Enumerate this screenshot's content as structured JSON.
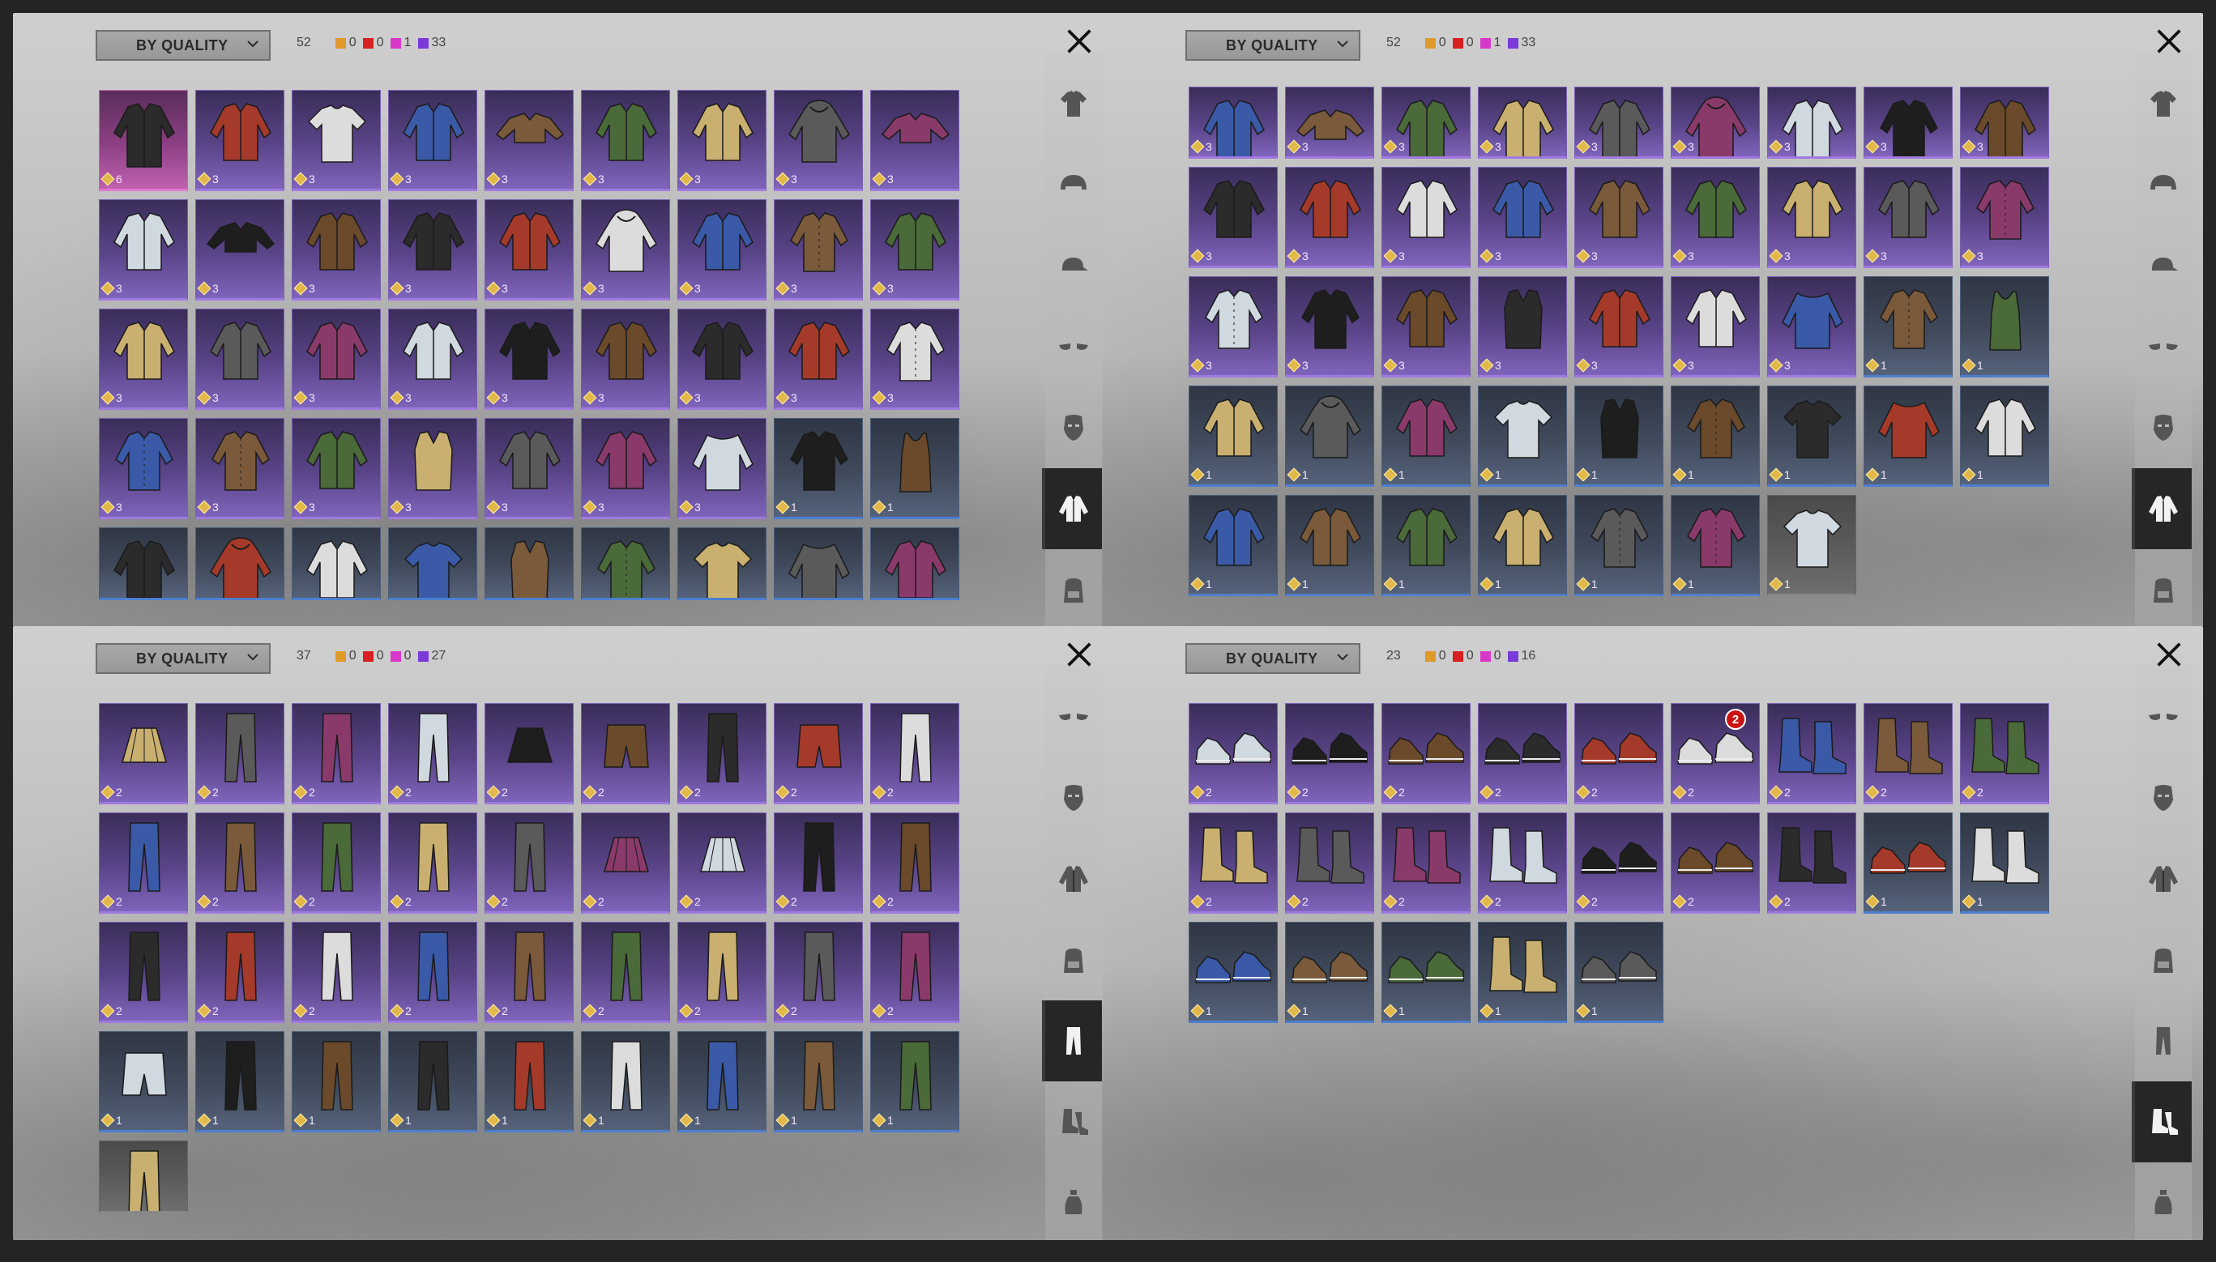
{
  "panels": [
    {
      "sort_label": "BY QUALITY",
      "total": "52",
      "counts": [
        {
          "color": "#e09a2a",
          "value": "0"
        },
        {
          "color": "#d82020",
          "value": "0"
        },
        {
          "color": "#d838c8",
          "value": "1"
        },
        {
          "color": "#7a3ad8",
          "value": "33"
        }
      ],
      "category_icon": "jacket-icon",
      "sidebar_icons": [
        "shirt-icon",
        "helmet-icon",
        "cap-icon",
        "glasses-icon",
        "mask-icon",
        "jacket-icon",
        "backpack-icon"
      ],
      "active_index": 5,
      "rows": [
        [
          {
            "t": "pink",
            "v": "6",
            "s": "coat"
          },
          {
            "t": "purple",
            "v": "3",
            "s": "jacket"
          },
          {
            "t": "purple",
            "v": "3",
            "s": "tshirt"
          },
          {
            "t": "purple",
            "v": "3",
            "s": "jacket"
          },
          {
            "t": "purple",
            "v": "3",
            "s": "crop"
          },
          {
            "t": "purple",
            "v": "3",
            "s": "jacket"
          },
          {
            "t": "purple",
            "v": "3",
            "s": "jacket"
          },
          {
            "t": "purple",
            "v": "3",
            "s": "hoodie"
          },
          {
            "t": "purple",
            "v": "3",
            "s": "crop"
          }
        ],
        [
          {
            "t": "purple",
            "v": "3",
            "s": "jacket"
          },
          {
            "t": "purple",
            "v": "3",
            "s": "crop"
          },
          {
            "t": "purple",
            "v": "3",
            "s": "jacket"
          },
          {
            "t": "purple",
            "v": "3",
            "s": "jacket"
          },
          {
            "t": "purple",
            "v": "3",
            "s": "jacket"
          },
          {
            "t": "purple",
            "v": "3",
            "s": "hoodie"
          },
          {
            "t": "purple",
            "v": "3",
            "s": "jacket"
          },
          {
            "t": "purple",
            "v": "3",
            "s": "shirt"
          },
          {
            "t": "purple",
            "v": "3",
            "s": "jacket"
          }
        ],
        [
          {
            "t": "purple",
            "v": "3",
            "s": "jacket"
          },
          {
            "t": "purple",
            "v": "3",
            "s": "jacket"
          },
          {
            "t": "purple",
            "v": "3",
            "s": "jacket"
          },
          {
            "t": "purple",
            "v": "3",
            "s": "jacket"
          },
          {
            "t": "purple",
            "v": "3",
            "s": "jacket"
          },
          {
            "t": "purple",
            "v": "3",
            "s": "jacket"
          },
          {
            "t": "purple",
            "v": "3",
            "s": "jacket"
          },
          {
            "t": "purple",
            "v": "3",
            "s": "jacket"
          },
          {
            "t": "purple",
            "v": "3",
            "s": "shirt"
          }
        ],
        [
          {
            "t": "purple",
            "v": "3",
            "s": "shirt"
          },
          {
            "t": "purple",
            "v": "3",
            "s": "shirt"
          },
          {
            "t": "purple",
            "v": "3",
            "s": "jacket"
          },
          {
            "t": "purple",
            "v": "3",
            "s": "vest"
          },
          {
            "t": "purple",
            "v": "3",
            "s": "jacket"
          },
          {
            "t": "purple",
            "v": "3",
            "s": "jacket"
          },
          {
            "t": "purple",
            "v": "3",
            "s": "sweater"
          },
          {
            "t": "blue",
            "v": "1",
            "s": "shirt"
          },
          {
            "t": "blue",
            "v": "1",
            "s": "tank"
          }
        ],
        [
          {
            "t": "blue",
            "v": "",
            "s": "jacket"
          },
          {
            "t": "blue",
            "v": "",
            "s": "hoodie"
          },
          {
            "t": "blue",
            "v": "",
            "s": "jacket"
          },
          {
            "t": "blue",
            "v": "",
            "s": "tshirt"
          },
          {
            "t": "blue",
            "v": "",
            "s": "vest"
          },
          {
            "t": "blue",
            "v": "",
            "s": "shirt"
          },
          {
            "t": "blue",
            "v": "",
            "s": "tshirt"
          },
          {
            "t": "blue",
            "v": "",
            "s": "sweater"
          },
          {
            "t": "blue",
            "v": "",
            "s": "jacket"
          }
        ]
      ]
    },
    {
      "sort_label": "BY QUALITY",
      "total": "52",
      "counts": [
        {
          "color": "#e09a2a",
          "value": "0"
        },
        {
          "color": "#d82020",
          "value": "0"
        },
        {
          "color": "#d838c8",
          "value": "1"
        },
        {
          "color": "#7a3ad8",
          "value": "33"
        }
      ],
      "sidebar_icons": [
        "shirt-icon",
        "helmet-icon",
        "cap-icon",
        "glasses-icon",
        "mask-icon",
        "jacket-icon",
        "backpack-icon"
      ],
      "active_index": 5,
      "rows": [
        [
          {
            "t": "purple",
            "v": "3",
            "s": "jacket"
          },
          {
            "t": "purple",
            "v": "3",
            "s": "crop"
          },
          {
            "t": "purple",
            "v": "3",
            "s": "jacket"
          },
          {
            "t": "purple",
            "v": "3",
            "s": "jacket"
          },
          {
            "t": "purple",
            "v": "3",
            "s": "jacket"
          },
          {
            "t": "purple",
            "v": "3",
            "s": "hoodie"
          },
          {
            "t": "purple",
            "v": "3",
            "s": "jacket"
          },
          {
            "t": "purple",
            "v": "3",
            "s": "shirt"
          },
          {
            "t": "purple",
            "v": "3",
            "s": "jacket"
          }
        ],
        [
          {
            "t": "purple",
            "v": "3",
            "s": "jacket"
          },
          {
            "t": "purple",
            "v": "3",
            "s": "jacket"
          },
          {
            "t": "purple",
            "v": "3",
            "s": "jacket"
          },
          {
            "t": "purple",
            "v": "3",
            "s": "jacket"
          },
          {
            "t": "purple",
            "v": "3",
            "s": "jacket"
          },
          {
            "t": "purple",
            "v": "3",
            "s": "jacket"
          },
          {
            "t": "purple",
            "v": "3",
            "s": "jacket"
          },
          {
            "t": "purple",
            "v": "3",
            "s": "jacket"
          },
          {
            "t": "purple",
            "v": "3",
            "s": "shirt"
          }
        ],
        [
          {
            "t": "purple",
            "v": "3",
            "s": "shirt"
          },
          {
            "t": "purple",
            "v": "3",
            "s": "shirt"
          },
          {
            "t": "purple",
            "v": "3",
            "s": "jacket"
          },
          {
            "t": "purple",
            "v": "3",
            "s": "vest"
          },
          {
            "t": "purple",
            "v": "3",
            "s": "jacket"
          },
          {
            "t": "purple",
            "v": "3",
            "s": "jacket"
          },
          {
            "t": "purple",
            "v": "3",
            "s": "sweater"
          },
          {
            "t": "blue",
            "v": "1",
            "s": "shirt"
          },
          {
            "t": "blue",
            "v": "1",
            "s": "tank"
          }
        ],
        [
          {
            "t": "blue",
            "v": "1",
            "s": "jacket"
          },
          {
            "t": "blue",
            "v": "1",
            "s": "hoodie"
          },
          {
            "t": "blue",
            "v": "1",
            "s": "jacket"
          },
          {
            "t": "blue",
            "v": "1",
            "s": "tshirt"
          },
          {
            "t": "blue",
            "v": "1",
            "s": "vest"
          },
          {
            "t": "blue",
            "v": "1",
            "s": "shirt"
          },
          {
            "t": "blue",
            "v": "1",
            "s": "tshirt"
          },
          {
            "t": "blue",
            "v": "1",
            "s": "sweater"
          },
          {
            "t": "blue",
            "v": "1",
            "s": "jacket"
          }
        ],
        [
          {
            "t": "blue",
            "v": "1",
            "s": "jacket"
          },
          {
            "t": "blue",
            "v": "1",
            "s": "jacket"
          },
          {
            "t": "blue",
            "v": "1",
            "s": "jacket"
          },
          {
            "t": "blue",
            "v": "1",
            "s": "jacket"
          },
          {
            "t": "blue",
            "v": "1",
            "s": "shirt"
          },
          {
            "t": "blue",
            "v": "1",
            "s": "shirt"
          },
          {
            "t": "grey",
            "v": "1",
            "s": "tshirt"
          }
        ]
      ]
    },
    {
      "sort_label": "BY QUALITY",
      "total": "37",
      "counts": [
        {
          "color": "#e09a2a",
          "value": "0"
        },
        {
          "color": "#d82020",
          "value": "0"
        },
        {
          "color": "#d838c8",
          "value": "0"
        },
        {
          "color": "#7a3ad8",
          "value": "27"
        }
      ],
      "sidebar_icons": [
        "glasses-icon",
        "mask-icon",
        "jacket-icon",
        "backpack-icon",
        "pants-icon",
        "boots-icon",
        "bottle-icon"
      ],
      "active_index": 4,
      "rows": [
        [
          {
            "t": "purple",
            "v": "2",
            "s": "skirt"
          },
          {
            "t": "purple",
            "v": "2",
            "s": "pants"
          },
          {
            "t": "purple",
            "v": "2",
            "s": "pants"
          },
          {
            "t": "purple",
            "v": "2",
            "s": "pants"
          },
          {
            "t": "purple",
            "v": "2",
            "s": "skirt"
          },
          {
            "t": "purple",
            "v": "2",
            "s": "shorts"
          },
          {
            "t": "purple",
            "v": "2",
            "s": "pants"
          },
          {
            "t": "purple",
            "v": "2",
            "s": "shorts"
          },
          {
            "t": "purple",
            "v": "2",
            "s": "pants"
          }
        ],
        [
          {
            "t": "purple",
            "v": "2",
            "s": "pants"
          },
          {
            "t": "purple",
            "v": "2",
            "s": "pants"
          },
          {
            "t": "purple",
            "v": "2",
            "s": "pants"
          },
          {
            "t": "purple",
            "v": "2",
            "s": "pants"
          },
          {
            "t": "purple",
            "v": "2",
            "s": "pants"
          },
          {
            "t": "purple",
            "v": "2",
            "s": "skirt"
          },
          {
            "t": "purple",
            "v": "2",
            "s": "skirt"
          },
          {
            "t": "purple",
            "v": "2",
            "s": "pants"
          },
          {
            "t": "purple",
            "v": "2",
            "s": "pants"
          }
        ],
        [
          {
            "t": "purple",
            "v": "2",
            "s": "pants"
          },
          {
            "t": "purple",
            "v": "2",
            "s": "pants"
          },
          {
            "t": "purple",
            "v": "2",
            "s": "pants"
          },
          {
            "t": "purple",
            "v": "2",
            "s": "pants"
          },
          {
            "t": "purple",
            "v": "2",
            "s": "pants"
          },
          {
            "t": "purple",
            "v": "2",
            "s": "pants"
          },
          {
            "t": "purple",
            "v": "2",
            "s": "pants"
          },
          {
            "t": "purple",
            "v": "2",
            "s": "pants"
          },
          {
            "t": "purple",
            "v": "2",
            "s": "pants"
          }
        ],
        [
          {
            "t": "blue",
            "v": "1",
            "s": "shorts"
          },
          {
            "t": "blue",
            "v": "1",
            "s": "pants"
          },
          {
            "t": "blue",
            "v": "1",
            "s": "pants"
          },
          {
            "t": "blue",
            "v": "1",
            "s": "pants"
          },
          {
            "t": "blue",
            "v": "1",
            "s": "pants"
          },
          {
            "t": "blue",
            "v": "1",
            "s": "pants"
          },
          {
            "t": "blue",
            "v": "1",
            "s": "pants"
          },
          {
            "t": "blue",
            "v": "1",
            "s": "pants"
          },
          {
            "t": "blue",
            "v": "1",
            "s": "pants"
          }
        ],
        [
          {
            "t": "grey",
            "v": "",
            "s": "pants"
          }
        ]
      ]
    },
    {
      "sort_label": "BY QUALITY",
      "total": "23",
      "counts": [
        {
          "color": "#e09a2a",
          "value": "0"
        },
        {
          "color": "#d82020",
          "value": "0"
        },
        {
          "color": "#d838c8",
          "value": "0"
        },
        {
          "color": "#7a3ad8",
          "value": "16"
        }
      ],
      "sidebar_icons": [
        "glasses-icon",
        "mask-icon",
        "jacket-icon",
        "backpack-icon",
        "pants-icon",
        "boots-icon",
        "bottle-icon"
      ],
      "active_index": 5,
      "rows": [
        [
          {
            "t": "purple",
            "v": "2",
            "s": "shoe"
          },
          {
            "t": "purple",
            "v": "2",
            "s": "shoe"
          },
          {
            "t": "purple",
            "v": "2",
            "s": "shoe"
          },
          {
            "t": "purple",
            "v": "2",
            "s": "shoe"
          },
          {
            "t": "purple",
            "v": "2",
            "s": "shoe"
          },
          {
            "t": "purple",
            "v": "2",
            "s": "shoe",
            "n": "2"
          },
          {
            "t": "purple",
            "v": "2",
            "s": "boot"
          },
          {
            "t": "purple",
            "v": "2",
            "s": "boot"
          },
          {
            "t": "purple",
            "v": "2",
            "s": "boot"
          }
        ],
        [
          {
            "t": "purple",
            "v": "2",
            "s": "boot"
          },
          {
            "t": "purple",
            "v": "2",
            "s": "boot"
          },
          {
            "t": "purple",
            "v": "2",
            "s": "boot"
          },
          {
            "t": "purple",
            "v": "2",
            "s": "boot"
          },
          {
            "t": "purple",
            "v": "2",
            "s": "shoe"
          },
          {
            "t": "purple",
            "v": "2",
            "s": "shoe"
          },
          {
            "t": "purple",
            "v": "2",
            "s": "boot"
          },
          {
            "t": "blue",
            "v": "1",
            "s": "shoe"
          },
          {
            "t": "blue",
            "v": "1",
            "s": "boot"
          }
        ],
        [
          {
            "t": "blue",
            "v": "1",
            "s": "shoe"
          },
          {
            "t": "blue",
            "v": "1",
            "s": "shoe"
          },
          {
            "t": "blue",
            "v": "1",
            "s": "shoe"
          },
          {
            "t": "blue",
            "v": "1",
            "s": "boot"
          },
          {
            "t": "blue",
            "v": "1",
            "s": "shoe"
          }
        ]
      ]
    }
  ]
}
